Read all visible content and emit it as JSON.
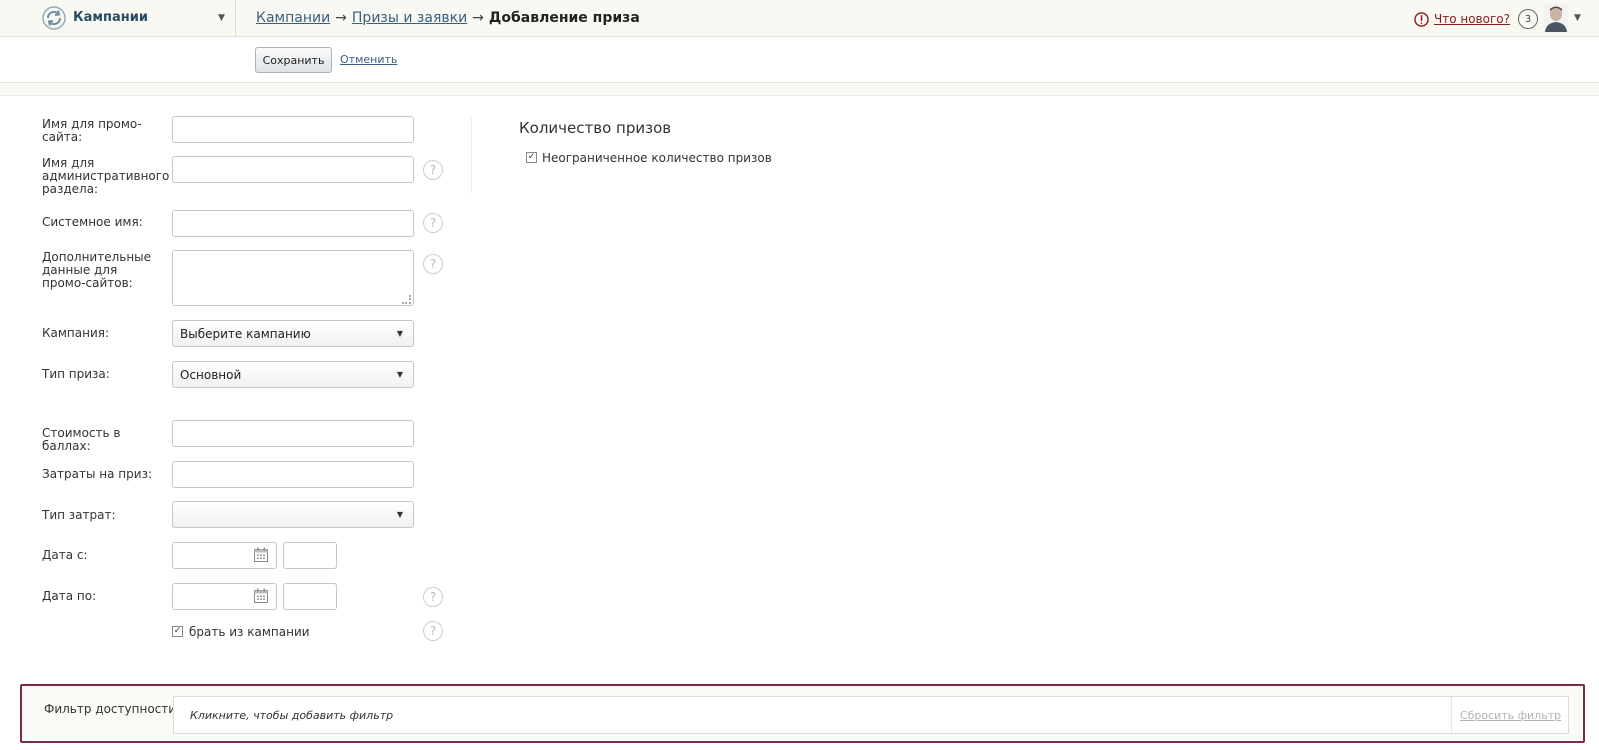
{
  "header": {
    "app_name": "Кампании",
    "breadcrumb": [
      {
        "label": "Кампании"
      },
      {
        "label": "Призы и заявки"
      }
    ],
    "breadcrumb_arrow": "→",
    "current_page": "Добавление приза",
    "whats_new": "Что нового?",
    "notifications_count": "3"
  },
  "toolbar": {
    "save_label": "Сохранить",
    "cancel_label": "Отменить"
  },
  "form": {
    "promo_name_label": "Имя для промо-сайта:",
    "admin_name_label": "Имя для административного раздела:",
    "system_name_label": "Системное имя:",
    "extra_data_label": "Дополнительные данные для промо-сайтов:",
    "campaign_label": "Кампания:",
    "campaign_value": "Выберите кампанию",
    "prize_type_label": "Тип приза:",
    "prize_type_value": "Основной",
    "cost_points_label": "Стоимость в баллах:",
    "prize_expense_label": "Затраты на приз:",
    "expense_type_label": "Тип затрат:",
    "expense_type_value": "",
    "date_from_label": "Дата с:",
    "date_to_label": "Дата по:",
    "take_from_campaign_label": "брать из кампании",
    "take_from_campaign_checked": true,
    "help_glyph": "?"
  },
  "prizes_section": {
    "title": "Количество призов",
    "unlimited_label": "Неограниченное количество призов",
    "unlimited_checked": true
  },
  "filter": {
    "label": "Фильтр доступности:",
    "hint": "Кликните, чтобы добавить фильтр",
    "reset_label": "Сбросить фильтр"
  },
  "colors": {
    "link": "#3a5f80",
    "whats_new": "#8b1a1a",
    "filter_border": "#7a2a4a"
  }
}
